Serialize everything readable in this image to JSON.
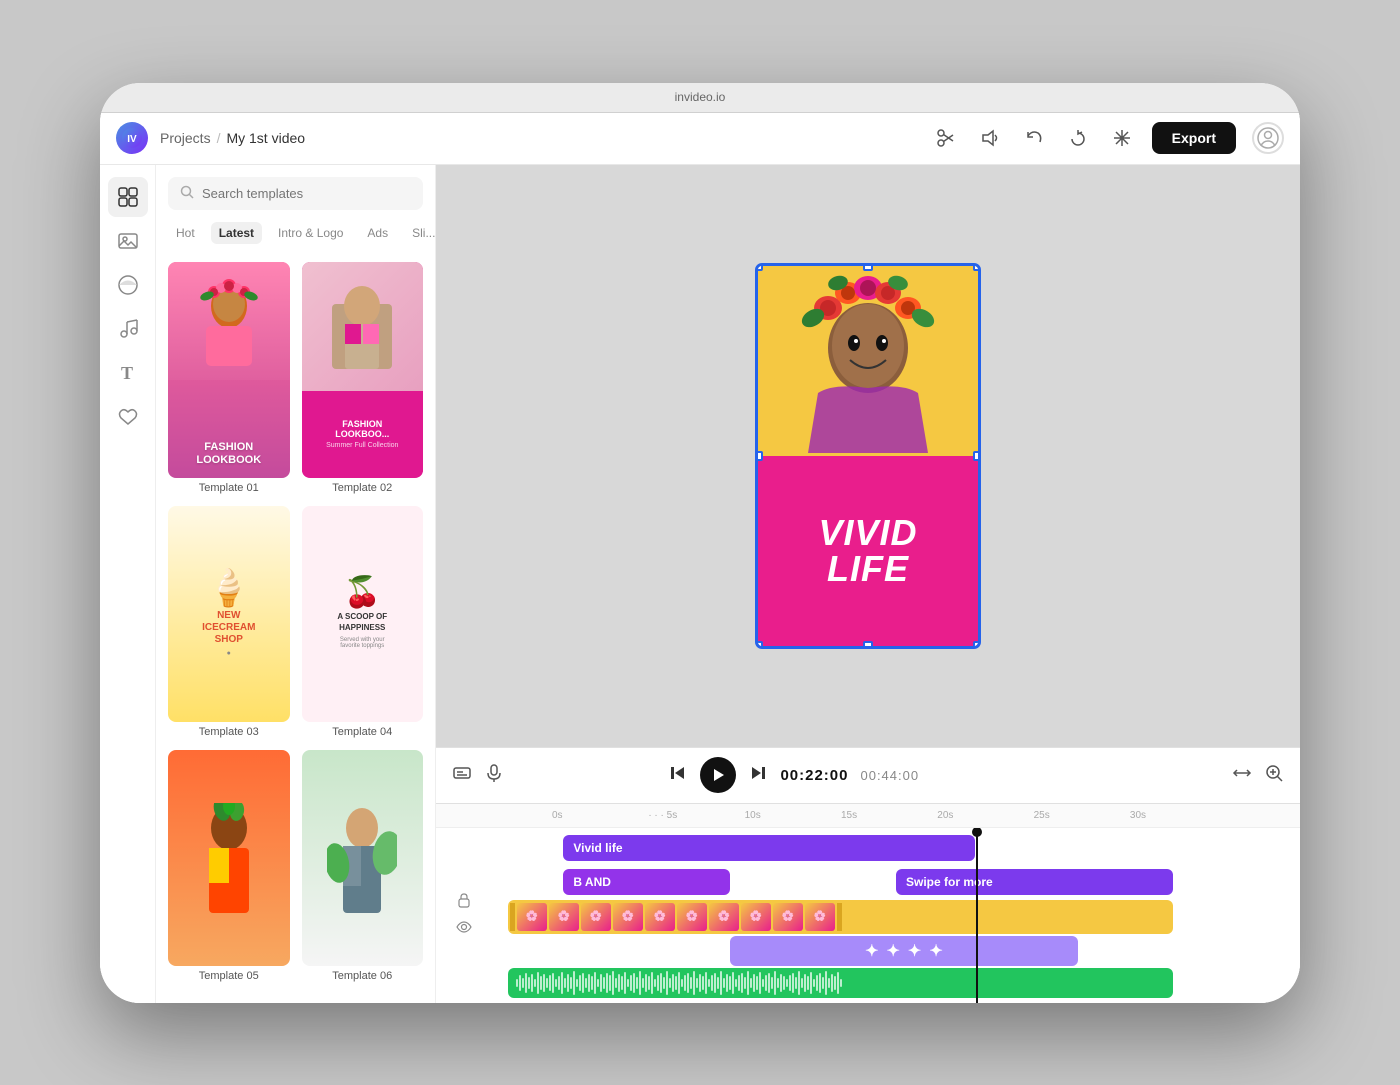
{
  "app": {
    "title": "invideo.io",
    "window_title": "invideo.io"
  },
  "header": {
    "logo_label": "IV",
    "breadcrumb": {
      "projects_label": "Projects",
      "separator": "/",
      "current": "My 1st video"
    },
    "tools": {
      "scissors_label": "✂",
      "volume_label": "🔊",
      "redo_label": "↩",
      "refresh_label": "↺",
      "magic_label": "✨"
    },
    "export_label": "Export"
  },
  "sidebar": {
    "icons": [
      {
        "name": "templates-icon",
        "symbol": "⊞",
        "active": true
      },
      {
        "name": "media-icon",
        "symbol": "🖼"
      },
      {
        "name": "effects-icon",
        "symbol": "◑"
      },
      {
        "name": "music-icon",
        "symbol": "♪"
      },
      {
        "name": "text-icon",
        "symbol": "T"
      },
      {
        "name": "favorites-icon",
        "symbol": "☆"
      }
    ]
  },
  "templates_panel": {
    "search_placeholder": "Search templates",
    "filter_tabs": [
      {
        "label": "Hot",
        "active": false
      },
      {
        "label": "Latest",
        "active": true
      },
      {
        "label": "Intro & Logo",
        "active": false
      },
      {
        "label": "Ads",
        "active": false
      },
      {
        "label": "Slides",
        "active": false
      }
    ],
    "templates": [
      {
        "id": "t01",
        "label": "Template 01",
        "theme": "fashion_lookbook",
        "title": "FASHION\nLOOKBOOK"
      },
      {
        "id": "t02",
        "label": "Template 02",
        "theme": "fashion_lookbook2",
        "title": "FASHION\nLOOKBOO..."
      },
      {
        "id": "t03",
        "label": "Template 03",
        "theme": "icecream",
        "title": "NEW\nICECREAM\nSHOP"
      },
      {
        "id": "t04",
        "label": "Template 04",
        "theme": "scoop",
        "title": "A SCOOP OF\nHAPPINESS"
      },
      {
        "id": "t05",
        "label": "Template 05",
        "theme": "colorful1",
        "title": ""
      },
      {
        "id": "t06",
        "label": "Template 06",
        "theme": "colorful2",
        "title": ""
      }
    ]
  },
  "preview": {
    "main_text_line1": "VIVID",
    "main_text_line2": "LIFE",
    "bg_color_top": "#f5c842",
    "bg_color_bottom": "#e91e8c"
  },
  "playback": {
    "current_time": "00:22:00",
    "total_time": "00:44:00"
  },
  "timeline": {
    "ruler_marks": [
      "0s",
      "5s",
      "10s",
      "15s",
      "20s",
      "25s",
      "30s"
    ],
    "tracks": [
      {
        "id": "track1",
        "label": "Vivid life",
        "color": "purple",
        "start_pct": 10,
        "width_pct": 50
      },
      {
        "id": "track2a",
        "label": "B AND",
        "color": "violet",
        "start_pct": 10,
        "width_pct": 20
      },
      {
        "id": "track2b",
        "label": "Swipe for more",
        "color": "violet-light",
        "start_pct": 50,
        "width_pct": 35
      },
      {
        "id": "track3",
        "label": "video",
        "color": "yellow",
        "start_pct": 2,
        "width_pct": 82
      },
      {
        "id": "track4",
        "label": "",
        "color": "motion",
        "start_pct": 30,
        "width_pct": 42
      },
      {
        "id": "track5",
        "label": "",
        "color": "audio",
        "start_pct": 2,
        "width_pct": 84
      }
    ]
  }
}
